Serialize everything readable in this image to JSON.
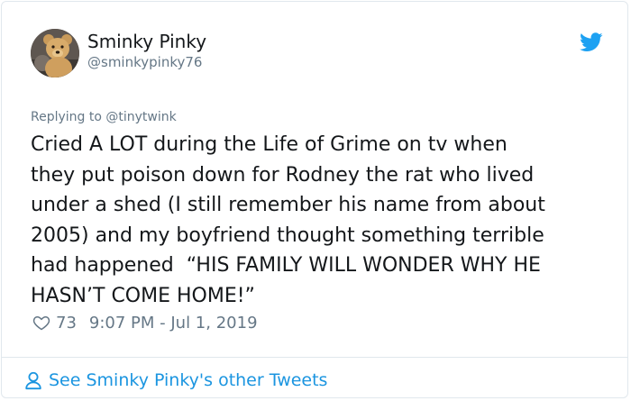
{
  "tweet": {
    "author_name": "Sminky Pinky",
    "author_handle": "@sminkypinky76",
    "replying_prefix": "Replying to ",
    "replying_to": "@tinytwink",
    "text": "Cried A LOT during the Life of Grime on tv when\nthey put poison down for Rodney the rat who lived\nunder a shed (I still remember his name from about\n2005) and my boyfriend thought something terrible\nhad happened  “HIS FAMILY WILL WONDER WHY HE\nHASN’T COME HOME!”",
    "likes": "73",
    "timestamp": "9:07 PM - Jul 1, 2019"
  },
  "footer": {
    "link_text": "See Sminky Pinky's other Tweets"
  },
  "icons": {
    "brand": "twitter-bird-icon",
    "like": "heart-icon",
    "profile": "person-icon"
  },
  "colors": {
    "brand_blue": "#1da1f2",
    "link_blue": "#1b95e0",
    "secondary_text": "#657786",
    "border": "#e1e8ed"
  }
}
